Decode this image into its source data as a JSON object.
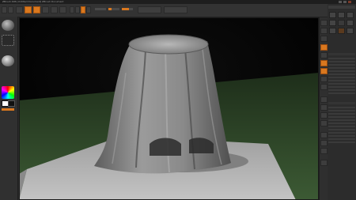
{
  "app": {
    "title": "ZBrush 4R6 [Untitled Document]   ZBrush Document"
  },
  "colors": {
    "accent": "#d9781f",
    "ui_dark": "#2b2b2b",
    "viewport_bg": "#000000",
    "floor": "#b5b5b5",
    "grid_plane": "#2f4a2a",
    "cloth": "#8a8a8a"
  },
  "toolbar": {
    "mode_buttons": [
      "edit-icon",
      "draw-icon",
      "move-icon",
      "scale-icon",
      "rotate-icon"
    ],
    "sliders": [
      {
        "name": "focal-shift",
        "level": 0.0
      },
      {
        "name": "z-intensity",
        "level": 0.25
      },
      {
        "name": "draw-size",
        "level": 0.64
      }
    ]
  },
  "left_shelf": {
    "tools": [
      "brush-icon",
      "stroke-icon",
      "material-icon",
      "color-picker-icon"
    ]
  },
  "right_panel": {
    "section_icons": [
      "camera-icon",
      "persp-icon",
      "floor-icon",
      "local-icon",
      "xyz-icon",
      "frame-icon",
      "move-icon",
      "scale-icon",
      "rotate-icon",
      "polyf-icon",
      "transp-icon",
      "solo-icon"
    ]
  },
  "viewport": {
    "scene": "draped-cloth-over-table-on-floor"
  }
}
